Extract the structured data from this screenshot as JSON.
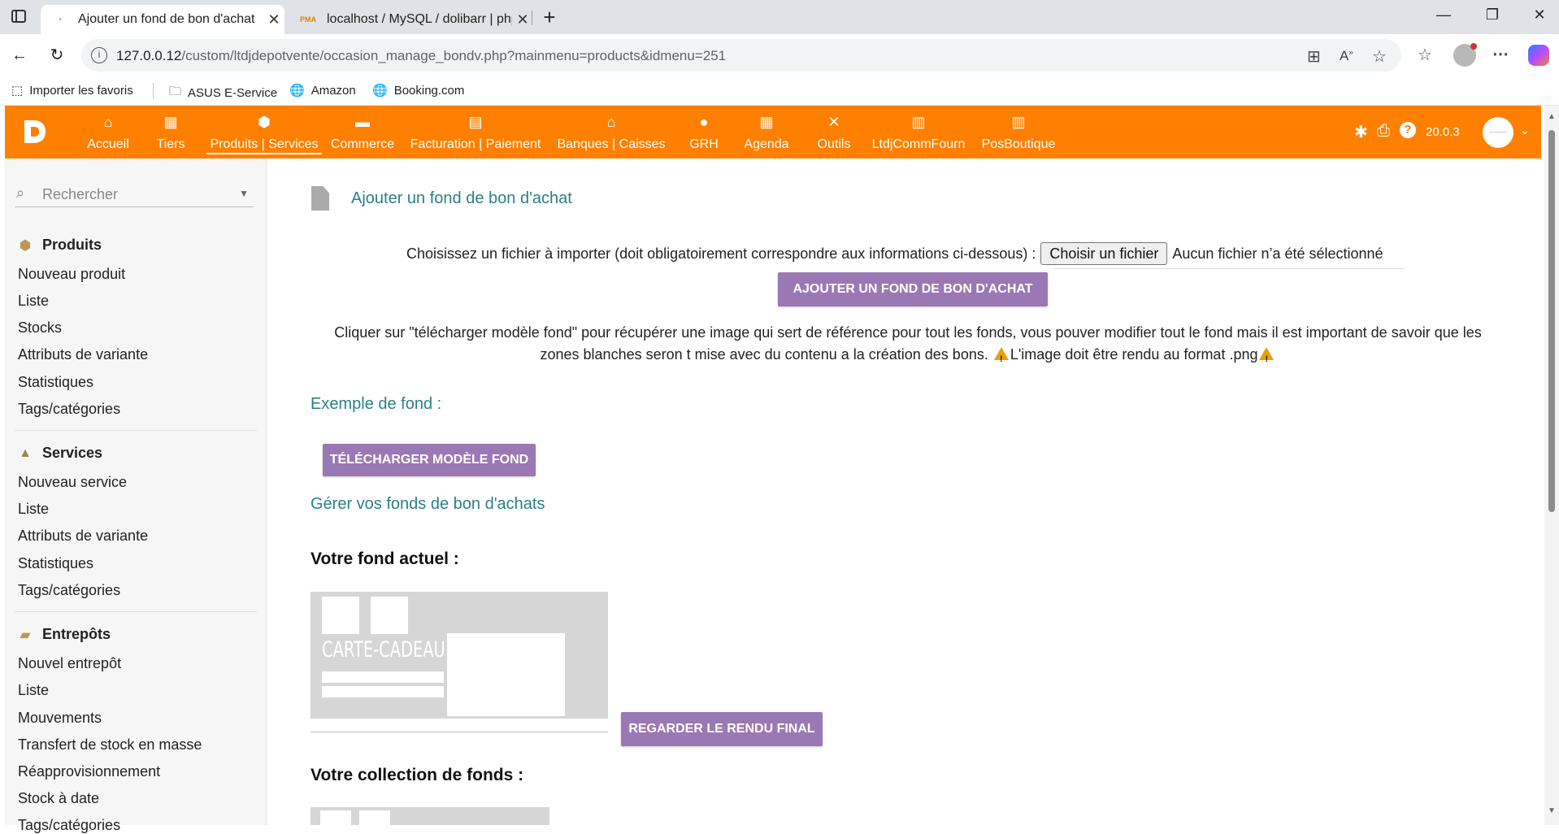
{
  "browser": {
    "tabs": [
      {
        "title": "Ajouter un fond de bon d'achat",
        "active": true
      },
      {
        "title": "localhost / MySQL / dolibarr | php",
        "active": false
      }
    ],
    "url_host": "127.0.0.12",
    "url_path": "/custom/ltdjdepotvente/occasion_manage_bondv.php?mainmenu=products&idmenu=251",
    "favorites": [
      "Importer les favoris",
      "ASUS E-Service",
      "Amazon",
      "Booking.com"
    ]
  },
  "topmenu": {
    "items": [
      {
        "label": "Accueil",
        "icon": "home-icon"
      },
      {
        "label": "Tiers",
        "icon": "building-icon"
      },
      {
        "label": "Produits | Services",
        "icon": "cube-icon"
      },
      {
        "label": "Commerce",
        "icon": "briefcase-icon"
      },
      {
        "label": "Facturation | Paiement",
        "icon": "invoice-icon"
      },
      {
        "label": "Banques | Caisses",
        "icon": "bank-icon"
      },
      {
        "label": "GRH",
        "icon": "user-tie-icon"
      },
      {
        "label": "Agenda",
        "icon": "calendar-icon"
      },
      {
        "label": "Outils",
        "icon": "tools-icon"
      },
      {
        "label": "LtdjCommFourn",
        "icon": "cash-register-icon"
      },
      {
        "label": "PosBoutique",
        "icon": "cash-register-icon"
      }
    ],
    "version": "20.0.3",
    "accent_color": "#ff8000"
  },
  "sidebar": {
    "search_placeholder": "Rechercher",
    "sections": [
      {
        "title": "Produits",
        "items": [
          "Nouveau produit",
          "Liste",
          "Stocks",
          "Attributs de variante",
          "Statistiques",
          "Tags/catégories"
        ]
      },
      {
        "title": "Services",
        "items": [
          "Nouveau service",
          "Liste",
          "Attributs de variante",
          "Statistiques",
          "Tags/catégories"
        ]
      },
      {
        "title": "Entrepôts",
        "items": [
          "Nouvel entrepôt",
          "Liste",
          "Mouvements",
          "Transfert de stock en masse",
          "Réapprovisionnement",
          "Stock à date",
          "Tags/catégories"
        ]
      }
    ]
  },
  "main": {
    "title": "Ajouter un fond de bon d'achat",
    "import_label": "Choisissez un fichier à importer (doit obligatoirement correspondre aux informations ci-dessous) :",
    "file_button": "Choisir un fichier",
    "no_file": "Aucun fichier n’a été sélectionné",
    "add_button": "AJOUTER UN FOND DE BON D'ACHAT",
    "info_text": "Cliquer sur \"télécharger modèle fond\" pour récupérer une image qui sert de référence pour tout les fonds, vous pouver modifier tout le fond mais il est important de savoir que les zones blanches seron t mise avec du contenu a la création des bons.",
    "info_warning": "L'image doit être rendu au format .png",
    "example_label": "Exemple de fond :",
    "download_button": "TÉLÉCHARGER MODÈLE FOND",
    "manage_link": "Gérer vos fonds de bon d'achats",
    "current_heading": "Votre fond actuel :",
    "voucher_text": "CARTE-CADEAU",
    "render_button": "REGARDER LE RENDU FINAL",
    "collection_heading": "Votre collection de fonds :",
    "button_color": "#9a78b3",
    "link_color": "#2b7f87"
  }
}
